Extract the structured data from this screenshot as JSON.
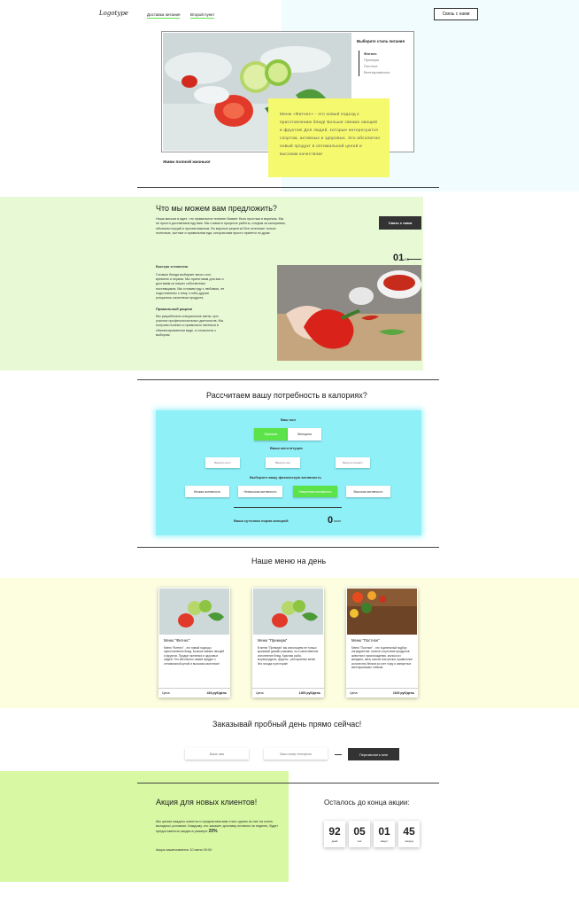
{
  "colors": {
    "cyan_bg": "#f0fcfd",
    "lime_bg": "#e8f9d6",
    "yellow_note": "#f5f96e",
    "calc_bg": "#8ff0f8",
    "active_green": "#5de34a",
    "cream_bg": "#fdfde0",
    "promo_green": "#d8f8a4",
    "dark_button": "#333333"
  },
  "header": {
    "logo": "Logotype",
    "nav": [
      "Доставка питания",
      "Второй пункт"
    ],
    "contact_button": "Связь с нами"
  },
  "hero": {
    "tagline": "Живи полной жизнью!",
    "styles_title": "Выберите стиль питания",
    "styles": [
      "Фитнес",
      "Премиум",
      "Постное",
      "Вегетарианское"
    ],
    "note": "Меню «Фитнес» - это новый подход к приготовлению блюд! Больше свежих овощей и фруктов! Для людей, которые интересуются спортом, активных и здоровых. Это абсолютно новый продукт в оптимальной ценой и высоким качеством!"
  },
  "offer": {
    "title": "Что мы можем вам предложить?",
    "intro": "Наша миссия в идее, что правильное питание бывает быть простым и вкусным. Мы не просто доставляем еду вам. Мы с вами в процессе работы, следим за калориями, объемом порций и прочим важным. Во вкусные рецепты! Все отличные только полезные, сытные и правильная еда, которая вам просто приятно по душе.",
    "contact_button": "Связь с нами",
    "slide_number": "01",
    "slide_total": "/05",
    "block1_title": "Быстро и полезно",
    "block1_text": "Готовые блюда выбирает много сил, времени и нервов. Мы приготовим для вас и доставим из наших собственных поставщиков. Мы готовим еду с любовью, ее подготовлены к тому, чтобы другие угощались качеством продукта.",
    "block2_title": "Правильный рацион",
    "block2_text": "Мы разработали специальное меню, при участии профессиональных диетологов. Мы получим полезно и правильно питаться в сбалансированном виде, и сложности с выбором."
  },
  "calc": {
    "title": "Рассчитаем вашу потребность в калориях?",
    "gender_label": "Ваш пол",
    "gender": [
      "Мужчина",
      "Женщина"
    ],
    "build_label": "Ваша конституция",
    "build_placeholders": [
      "Введите рост",
      "Введите вес",
      "Введите возраст"
    ],
    "activity_label": "Выберите вашу физическую активность",
    "activity": [
      "Низкая активность",
      "Невысокая активность",
      "Умеренная активность",
      "Высокая активность"
    ],
    "result_label": "Ваша суточная норма калорий:",
    "result_value": "0",
    "result_unit": "ккал"
  },
  "menu": {
    "title": "Наше меню на день",
    "cards": [
      {
        "title": "Меню \"Фитнес\"",
        "desc": "Меню \"Фитнес\" - это новый подход к приготовлению блюд. Больше свежих овощей и фруктов. Продукт активных и здоровых людей. Это абсолютно новый продукт с оптимальной ценой и высоким качеством!",
        "price_label": "Цена:",
        "price": "416 руб/день"
      },
      {
        "title": "Меню \"Премиум\"",
        "desc": "В меню \"Премиум\" мы используем не только красивый дизайн упаковки, но и качественное исполнение блюд. Красная рыба, морепродукты, фрукты - ресторанное меню без похода в ресторан!",
        "price_label": "Цена:",
        "price": "1400 руб/день"
      },
      {
        "title": "Меню \"Постное\"",
        "desc": "Меню \"Постное\" - это тщательный подбор ингредиентов: полное отсутствие продуктов животного происхождения, молоко из миндаля, овса, кокоса или гречки, правильное количество белков за счет тофу и импортных вегетарианских стейков.",
        "price_label": "Цена:",
        "price": "1100 руб/день"
      }
    ]
  },
  "order": {
    "title": "Заказывай пробный день прямо сейчас!",
    "name_placeholder": "Ваше имя",
    "phone_placeholder": "Ваш номер телефона",
    "button": "Перезвонить мне"
  },
  "promo": {
    "title": "Акция для новых клиентов!",
    "text": "Мы ценим каждого клиента и предлагаем вам стать одним из них на очень выгодных условиях. Каждому, кто закажет доставку питания на неделю, будет предоставлена скидка в размере",
    "discount": "20%",
    "deadline": "Акция заканчивается 10 июня 00:00",
    "timer_title": "Осталось до конца акции:",
    "timer": [
      {
        "value": "92",
        "label": "дней"
      },
      {
        "value": "05",
        "label": "час"
      },
      {
        "value": "01",
        "label": "минут"
      },
      {
        "value": "45",
        "label": "секунд"
      }
    ]
  }
}
